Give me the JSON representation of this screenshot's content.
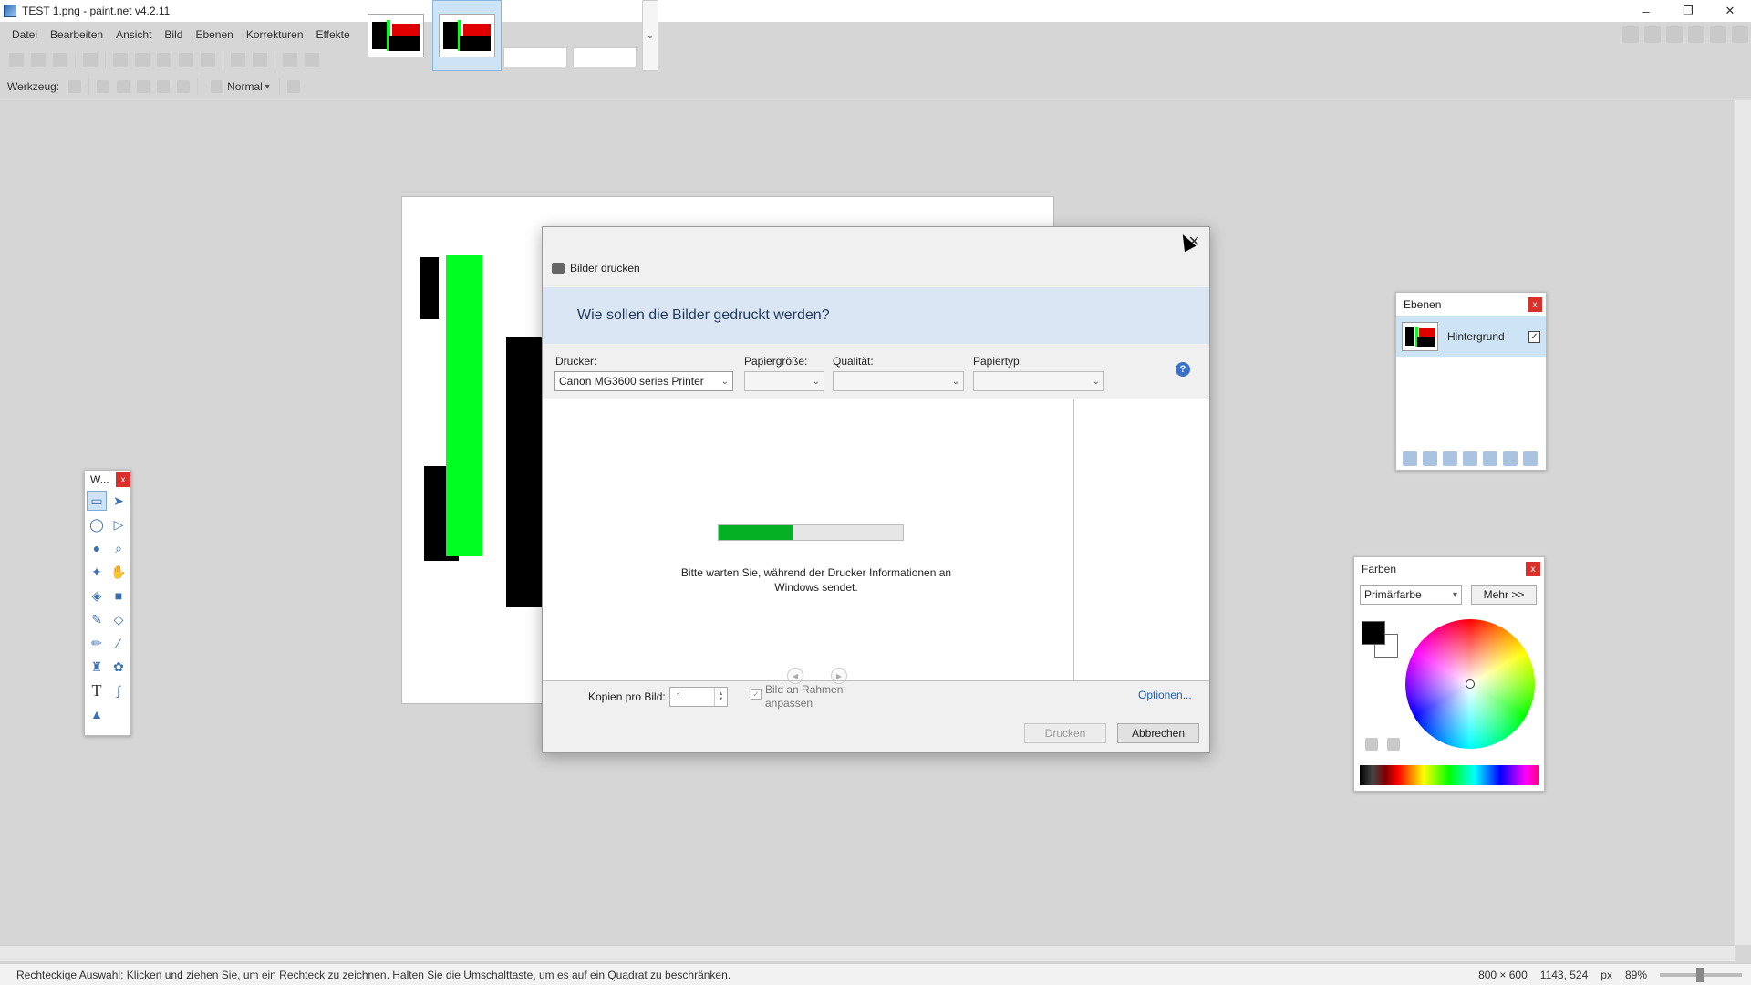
{
  "window": {
    "title": "TEST 1.png - paint.net v4.2.11",
    "minimize": "–",
    "restore": "❐",
    "close": "✕"
  },
  "menu": [
    "Datei",
    "Bearbeiten",
    "Ansicht",
    "Bild",
    "Ebenen",
    "Korrekturen",
    "Effekte"
  ],
  "toolbar": {
    "tool_label": "Werkzeug:",
    "blend_mode": "Normal",
    "thumb_scroll": "⌄"
  },
  "tools_window": {
    "title": "W...",
    "close": "x"
  },
  "layers_window": {
    "title": "Ebenen",
    "close": "x",
    "layer_name": "Hintergrund",
    "layer_visible": "✓"
  },
  "colors_window": {
    "title": "Farben",
    "close": "x",
    "primary_select": "Primärfarbe",
    "more_button": "Mehr >>"
  },
  "dialog": {
    "close": "✕",
    "title": "Bilder drucken",
    "heading": "Wie sollen die Bilder gedruckt werden?",
    "printer_label": "Drucker:",
    "printer_value": "Canon MG3600 series Printer",
    "paper_size_label": "Papiergröße:",
    "quality_label": "Qualität:",
    "paper_type_label": "Papiertyp:",
    "help": "?",
    "progress_fraction": 0.4,
    "wait_line1": "Bitte warten Sie, während der Drucker Informationen an",
    "wait_line2": "Windows sendet.",
    "prev": "◀",
    "next": "▶",
    "copies_label": "Kopien pro Bild:",
    "copies_value": "1",
    "fit_check": "✓",
    "fit_label_line1": "Bild an Rahmen",
    "fit_label_line2": "anpassen",
    "options_link": "Optionen...",
    "print_button": "Drucken",
    "cancel_button": "Abbrechen"
  },
  "status": {
    "hint": "Rechteckige Auswahl: Klicken und ziehen Sie, um ein Rechteck zu zeichnen. Halten Sie die Umschalttaste, um es auf ein Quadrat zu beschränken.",
    "image_size": "800 × 600",
    "cursor_pos": "1143, 524",
    "unit": "px",
    "zoom": "89%"
  },
  "colors": {
    "green": "#00ff20",
    "red": "#e00000",
    "accent": "#06b025"
  }
}
